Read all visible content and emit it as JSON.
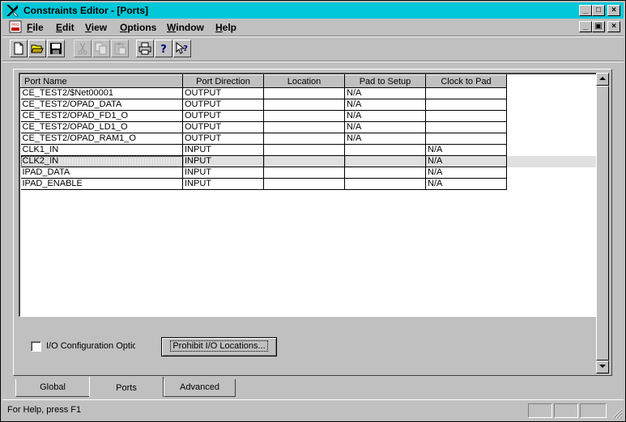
{
  "window": {
    "title": "Constraints Editor - [Ports]",
    "minimize": "_",
    "maximize": "□",
    "close": "×"
  },
  "menu": {
    "items": [
      {
        "label": "File",
        "u": "F",
        "rest": "ile"
      },
      {
        "label": "Edit",
        "u": "E",
        "rest": "dit"
      },
      {
        "label": "View",
        "u": "V",
        "rest": "iew"
      },
      {
        "label": "Options",
        "u": "O",
        "rest": "ptions"
      },
      {
        "label": "Window",
        "u": "W",
        "rest": "indow"
      },
      {
        "label": "Help",
        "u": "H",
        "rest": "elp"
      }
    ],
    "doc_icon_text": "PRO"
  },
  "toolbar": {
    "buttons": [
      "new-icon",
      "open-icon",
      "save-icon",
      "cut-icon",
      "copy-icon",
      "paste-icon",
      "print-icon",
      "help-icon",
      "context-help-icon"
    ]
  },
  "grid": {
    "columns": [
      "Port Name",
      "Port Direction",
      "Location",
      "Pad to Setup",
      "Clock to Pad"
    ],
    "rows": [
      {
        "name": "CE_TEST2/$Net00001",
        "direction": "OUTPUT",
        "location": "",
        "pad_to_setup": "N/A",
        "clock_to_pad": "",
        "selected": false
      },
      {
        "name": "CE_TEST2/OPAD_DATA",
        "direction": "OUTPUT",
        "location": "",
        "pad_to_setup": "N/A",
        "clock_to_pad": "",
        "selected": false
      },
      {
        "name": "CE_TEST2/OPAD_FD1_O",
        "direction": "OUTPUT",
        "location": "",
        "pad_to_setup": "N/A",
        "clock_to_pad": "",
        "selected": false
      },
      {
        "name": "CE_TEST2/OPAD_LD1_O",
        "direction": "OUTPUT",
        "location": "",
        "pad_to_setup": "N/A",
        "clock_to_pad": "",
        "selected": false
      },
      {
        "name": "CE_TEST2/OPAD_RAM1_O",
        "direction": "OUTPUT",
        "location": "",
        "pad_to_setup": "N/A",
        "clock_to_pad": "",
        "selected": false
      },
      {
        "name": "CLK1_IN",
        "direction": "INPUT",
        "location": "",
        "pad_to_setup": "",
        "clock_to_pad": "N/A",
        "selected": false
      },
      {
        "name": "CLK2_IN",
        "direction": "INPUT",
        "location": "",
        "pad_to_setup": "",
        "clock_to_pad": "N/A",
        "selected": true
      },
      {
        "name": "IPAD_DATA",
        "direction": "INPUT",
        "location": "",
        "pad_to_setup": "",
        "clock_to_pad": "N/A",
        "selected": false
      },
      {
        "name": "IPAD_ENABLE",
        "direction": "INPUT",
        "location": "",
        "pad_to_setup": "",
        "clock_to_pad": "N/A",
        "selected": false
      }
    ]
  },
  "options": {
    "io_config_label": "I/O Configuration Optior",
    "io_config_checked": false,
    "prohibit_button": "Prohibit I/O Locations..."
  },
  "tabs": [
    {
      "label": "Global",
      "active": false
    },
    {
      "label": "Ports",
      "active": true
    },
    {
      "label": "Advanced",
      "active": false
    }
  ],
  "status": {
    "text": "For Help, press F1"
  },
  "colors": {
    "titlebar": "#00c8d8",
    "face": "#c0c0c0"
  }
}
